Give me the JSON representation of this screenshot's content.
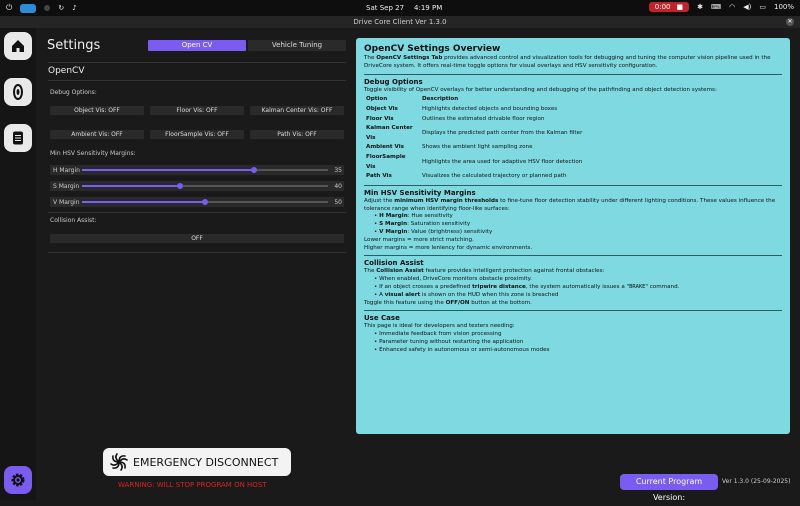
{
  "system": {
    "date": "Sat Sep 27",
    "time": "4:19 PM",
    "rec_time": "0:00",
    "battery": "100%"
  },
  "window": {
    "title": "Drive Core Client Ver 1.3.0"
  },
  "settings": {
    "title": "Settings",
    "tabs": [
      "Open CV",
      "Vehicle Tuning"
    ],
    "section": "OpenCV",
    "debug_label": "Debug Options:",
    "debug_buttons": [
      "Object Vis: OFF",
      "Floor Vis: OFF",
      "Kalman Center Vis: OFF",
      "Ambient Vis: OFF",
      "FloorSample Vis: OFF",
      "Path Vis: OFF"
    ],
    "hsv_label": "Min HSV Sensitivity Margins:",
    "sliders": [
      {
        "name": "H Margin",
        "value": 35,
        "max": 50
      },
      {
        "name": "S Margin",
        "value": 40,
        "max": 100
      },
      {
        "name": "V Margin",
        "value": 50,
        "max": 100
      }
    ],
    "collision_label": "Collision Assist:",
    "collision_button": "OFF"
  },
  "emergency": {
    "label": "EMERGENCY DISCONNECT",
    "warning": "WARNING: WILL STOP PROGRAM ON HOST"
  },
  "version": {
    "label": "Current Program Version:",
    "value": "Ver 1.3.0 (25-09-2025)"
  },
  "overview": {
    "title": "OpenCV Settings Overview",
    "intro_pre": "The ",
    "intro_bold": "OpenCV Settings Tab",
    "intro_post": " provides advanced control and visualization tools for debugging and tuning the computer vision pipeline used in the DriveCore system. It offers real-time toggle options for visual overlays and HSV sensitivity configuration.",
    "debug_title": "Debug Options",
    "debug_intro": "Toggle visibility of OpenCV overlays for better understanding and debugging of the pathfinding and object detection systems:",
    "table_headers": [
      "Option",
      "Description"
    ],
    "table_rows": [
      [
        "Object Vis",
        "Highlights detected objects and bounding boxes"
      ],
      [
        "Floor Vis",
        "Outlines the estimated drivable floor region"
      ],
      [
        "Kalman Center Vis",
        "Displays the predicted path center from the Kalman filter"
      ],
      [
        "Ambient Vis",
        "Shows the ambient light sampling zone"
      ],
      [
        "FloorSample Vis",
        "Highlights the area used for adaptive HSV floor detection"
      ],
      [
        "Path Vis",
        "Visualizes the calculated trajectory or planned path"
      ]
    ],
    "hsv_title": "Min HSV Sensitivity Margins",
    "hsv_pre": "Adjust the ",
    "hsv_bold": "minimum HSV margin thresholds",
    "hsv_post": " to fine-tune floor detection stability under different lighting conditions. These values influence the tolerance range when identifying floor-like surfaces:",
    "hsv_items": [
      {
        "bold": "H Margin",
        "text": ": Hue sensitivity"
      },
      {
        "bold": "S Margin",
        "text": ": Saturation sensitivity"
      },
      {
        "bold": "V Margin",
        "text": ": Value (brightness) sensitivity"
      }
    ],
    "hsv_note1": "Lower margins = more strict matching.",
    "hsv_note2": "Higher margins = more leniency for dynamic environments.",
    "collision_title": "Collision Assist",
    "collision_pre": "The ",
    "collision_bold": "Collision Assist",
    "collision_post": " feature provides intelligent protection against frontal obstacles:",
    "collision_item1": "When enabled, DriveCore monitors obstacle proximity.",
    "collision_item2_pre": "If an object crosses a predefined ",
    "collision_item2_bold": "tripwire distance",
    "collision_item2_mid": ", the system automatically issues a \"",
    "collision_item2_code": "BRAKE",
    "collision_item2_post": "\" command.",
    "collision_item3_pre": "A ",
    "collision_item3_bold": "visual alert",
    "collision_item3_post": " is shown on the HUD when this zone is breached",
    "collision_toggle_pre": "Toggle this feature using the ",
    "collision_toggle_bold": "OFF/ON",
    "collision_toggle_post": " button at the bottom.",
    "usecase_title": "Use Case",
    "usecase_intro": "This page is ideal for developers and testers needing:",
    "usecase_items": [
      "Immediate feedback from vision processing",
      "Parameter tuning without restarting the application",
      "Enhanced safety in autonomous or semi-autonomous modes"
    ]
  }
}
